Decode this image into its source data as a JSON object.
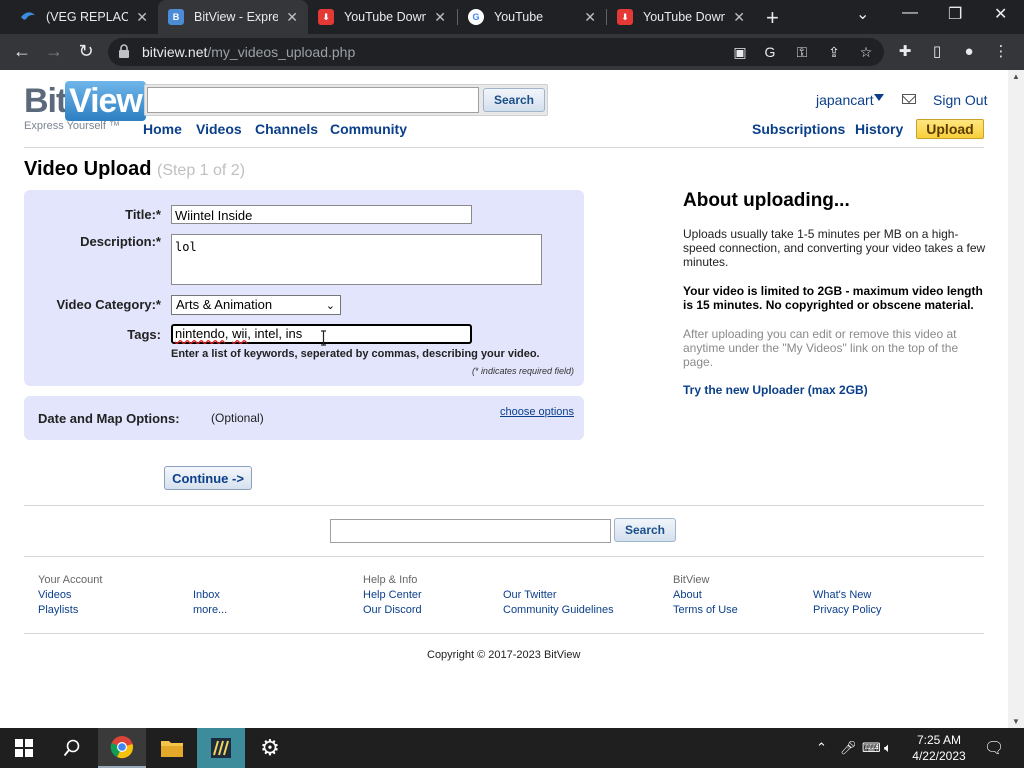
{
  "browser": {
    "tabs": [
      {
        "title": "(VEG REPLACE)[I",
        "favicon": "veg-icon",
        "color": "#3c8de0"
      },
      {
        "title": "BitView - Expres",
        "favicon": "bitview-icon",
        "color": "#4c8cd6",
        "active": true
      },
      {
        "title": "YouTube Downl",
        "favicon": "download-icon",
        "color": "#e53935"
      },
      {
        "title": "YouTube",
        "favicon": "google-icon",
        "color": "#4285f4"
      },
      {
        "title": "YouTube Downl",
        "favicon": "download-icon",
        "color": "#e53935"
      }
    ],
    "url_host": "bitview.net",
    "url_path": "/my_videos_upload.php"
  },
  "site": {
    "logo_bit": "Bit",
    "logo_view": "View",
    "slogan": "Express Yourself ™",
    "search_button": "Search",
    "nav": [
      "Home",
      "Videos",
      "Channels",
      "Community"
    ],
    "username": "japancart",
    "sign_out": "Sign Out",
    "subscriptions": "Subscriptions",
    "history": "History",
    "upload": "Upload"
  },
  "form": {
    "heading": "Video Upload",
    "step": "(Step 1 of 2)",
    "title_label": "Title:*",
    "title_value": "Wiintel Inside",
    "description_label": "Description:*",
    "description_value": "lol",
    "category_label": "Video Category:*",
    "category_value": "Arts & Animation",
    "tags_label": "Tags:",
    "tags_value_a": "nintendo",
    "tags_value_b": ", ",
    "tags_value_c": "wii",
    "tags_value_d": ", intel, ins",
    "tags_hint": "Enter a list of keywords, seperated by commas, describing your video.",
    "required_note": "(* indicates required field)",
    "options_label": "Date and Map Options:",
    "options_optional": "(Optional)",
    "choose_options": "choose options",
    "continue": "Continue ->"
  },
  "aside": {
    "title": "About uploading...",
    "p1": "Uploads usually take 1-5 minutes per MB on a high-speed connection, and converting your video takes a few minutes.",
    "p2": "Your video is limited to 2GB - maximum video length is 15 minutes. No copyrighted or obscene material.",
    "p3": "After uploading you can edit or remove this video at anytime under the \"My Videos\" link on the top of the page.",
    "try": "Try the new Uploader (max 2GB)"
  },
  "footer": {
    "bottom_search": "Search",
    "your_account": "Your Account",
    "videos": "Videos",
    "playlists": "Playlists",
    "inbox": "Inbox",
    "more": "more...",
    "help_info": "Help & Info",
    "help_center": "Help Center",
    "our_discord": "Our Discord",
    "our_twitter": "Our Twitter",
    "community_guidelines": "Community Guidelines",
    "bitview": "BitView",
    "about": "About",
    "terms": "Terms of Use",
    "whats_new": "What's New",
    "privacy": "Privacy Policy",
    "copyright": "Copyright © 2017-2023 BitView"
  },
  "taskbar": {
    "time": "7:25 AM",
    "date": "4/22/2023"
  }
}
